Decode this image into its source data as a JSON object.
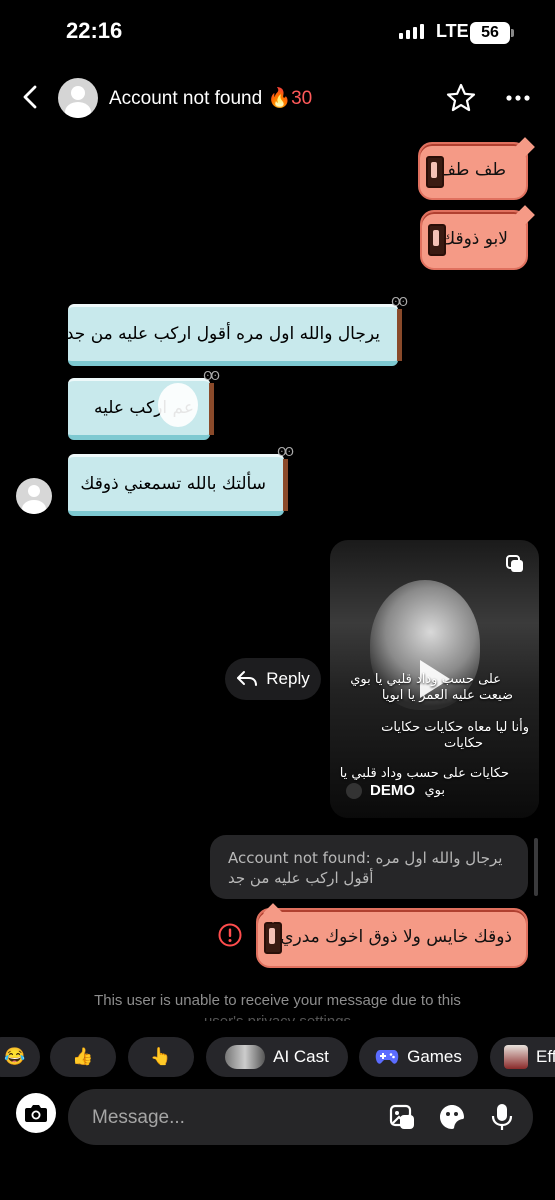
{
  "status_bar": {
    "time": "22:16",
    "network": "LTE",
    "battery": "56"
  },
  "header": {
    "title": "Account not found",
    "streak": "🔥30"
  },
  "messages": {
    "sent_1": "طف طف",
    "sent_2": "لابو ذوقك",
    "recv_1": "يرجال والله اول مره أقول اركب عليه من جد",
    "recv_2": "عم اركب عليه",
    "recv_3": "سألتك بالله تسمعني ذوقك",
    "sent_3": "ذوقك خايس ولا ذوق اخوك مدري"
  },
  "reel": {
    "caption_1": "على حسب وداد قلبي يا بوي",
    "caption_2": "ضيعت عليه العمر يا ابويا",
    "caption_3": "وأنا ليا معاه حكايات حكايات",
    "caption_4": "حكايات",
    "caption_5": "حكايات على حسب وداد قلبي يا",
    "caption_6": "بوي",
    "author": "DEMO",
    "reply_label": "Reply"
  },
  "quote": {
    "line_1": "Account not found: يرجال والله اول مره",
    "line_2": "أقول اركب عليه من جد"
  },
  "system_message": {
    "line_1": "This user is unable to receive your message due to this",
    "line_2": "user's privacy settings"
  },
  "quick_replies": {
    "emoji_1": "😂",
    "emoji_2": "👍",
    "emoji_3": "👆",
    "ai_cast": "AI Cast",
    "games": "Games",
    "effects": "Eff"
  },
  "composer": {
    "placeholder": "Message..."
  },
  "colors": {
    "sent_bubble": "#f59a86",
    "received_bubble": "#c8e9ec",
    "error": "#ff4d4d",
    "background": "#000000"
  }
}
